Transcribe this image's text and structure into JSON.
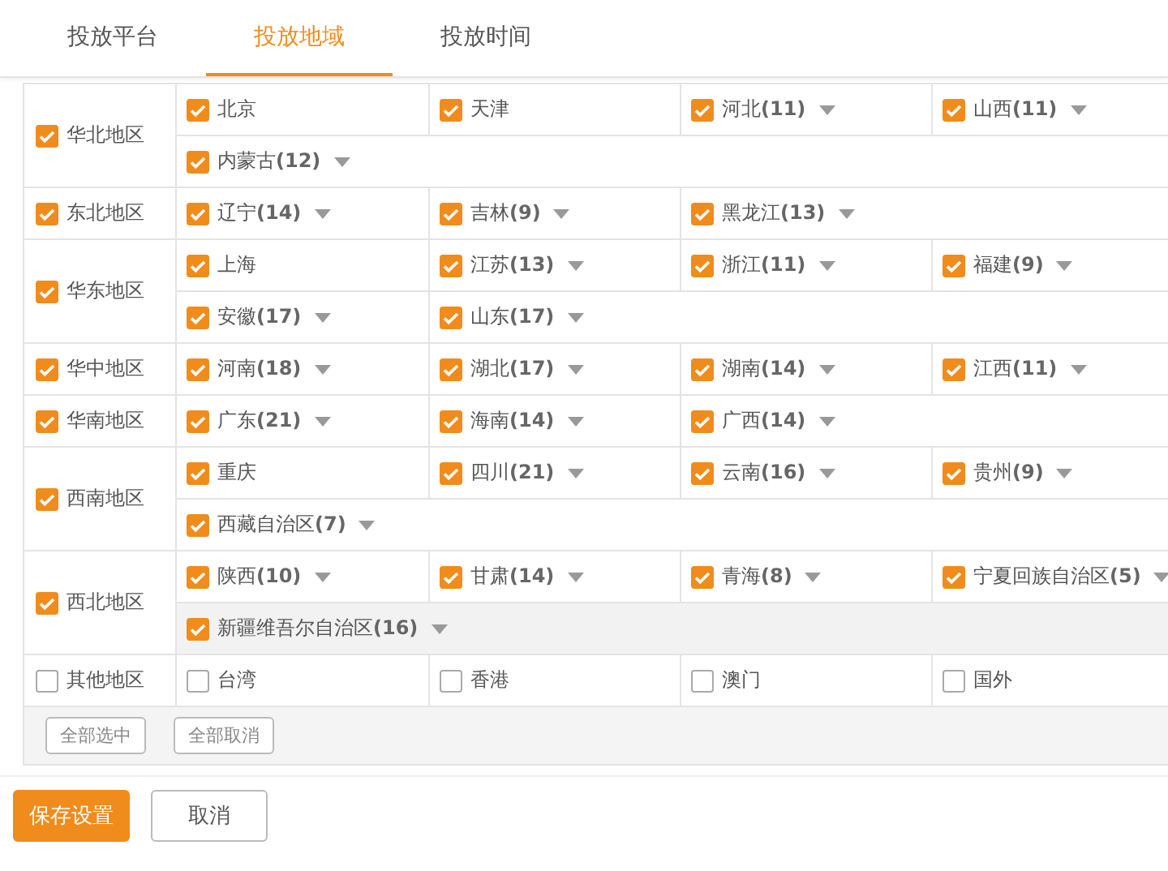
{
  "tabs": [
    {
      "label": "投放平台",
      "selected": false
    },
    {
      "label": "投放地域",
      "selected": true
    },
    {
      "label": "投放时间",
      "selected": false
    }
  ],
  "regions": [
    {
      "name": "华北地区",
      "checked": true,
      "lines": [
        {
          "hovered": false,
          "provinces": [
            {
              "name": "北京",
              "checked": true
            },
            {
              "name": "天津",
              "checked": true
            },
            {
              "name": "河北",
              "count": "(11)",
              "checked": true
            },
            {
              "name": "山西",
              "count": "(11)",
              "checked": true
            }
          ]
        },
        {
          "hovered": false,
          "provinces": [
            {
              "name": "内蒙古",
              "count": "(12)",
              "checked": true
            }
          ]
        }
      ]
    },
    {
      "name": "东北地区",
      "checked": true,
      "lines": [
        {
          "hovered": false,
          "provinces": [
            {
              "name": "辽宁",
              "count": "(14)",
              "checked": true
            },
            {
              "name": "吉林",
              "count": "(9)",
              "checked": true
            },
            {
              "name": "黑龙江",
              "count": "(13)",
              "checked": true
            }
          ]
        }
      ]
    },
    {
      "name": "华东地区",
      "checked": true,
      "lines": [
        {
          "hovered": false,
          "provinces": [
            {
              "name": "上海",
              "checked": true
            },
            {
              "name": "江苏",
              "count": "(13)",
              "checked": true
            },
            {
              "name": "浙江",
              "count": "(11)",
              "checked": true
            },
            {
              "name": "福建",
              "count": "(9)",
              "checked": true
            }
          ]
        },
        {
          "hovered": false,
          "provinces": [
            {
              "name": "安徽",
              "count": "(17)",
              "checked": true
            },
            {
              "name": "山东",
              "count": "(17)",
              "checked": true
            }
          ]
        }
      ]
    },
    {
      "name": "华中地区",
      "checked": true,
      "lines": [
        {
          "hovered": false,
          "provinces": [
            {
              "name": "河南",
              "count": "(18)",
              "checked": true
            },
            {
              "name": "湖北",
              "count": "(17)",
              "checked": true
            },
            {
              "name": "湖南",
              "count": "(14)",
              "checked": true
            },
            {
              "name": "江西",
              "count": "(11)",
              "checked": true
            }
          ]
        }
      ]
    },
    {
      "name": "华南地区",
      "checked": true,
      "lines": [
        {
          "hovered": false,
          "provinces": [
            {
              "name": "广东",
              "count": "(21)",
              "checked": true
            },
            {
              "name": "海南",
              "count": "(14)",
              "checked": true
            },
            {
              "name": "广西",
              "count": "(14)",
              "checked": true
            }
          ]
        }
      ]
    },
    {
      "name": "西南地区",
      "checked": true,
      "lines": [
        {
          "hovered": false,
          "provinces": [
            {
              "name": "重庆",
              "checked": true
            },
            {
              "name": "四川",
              "count": "(21)",
              "checked": true
            },
            {
              "name": "云南",
              "count": "(16)",
              "checked": true
            },
            {
              "name": "贵州",
              "count": "(9)",
              "checked": true
            }
          ]
        },
        {
          "hovered": false,
          "provinces": [
            {
              "name": "西藏自治区",
              "count": "(7)",
              "checked": true
            }
          ]
        }
      ]
    },
    {
      "name": "西北地区",
      "checked": true,
      "lines": [
        {
          "hovered": false,
          "provinces": [
            {
              "name": "陕西",
              "count": "(10)",
              "checked": true
            },
            {
              "name": "甘肃",
              "count": "(14)",
              "checked": true
            },
            {
              "name": "青海",
              "count": "(8)",
              "checked": true
            },
            {
              "name": "宁夏回族自治区",
              "count": "(5)",
              "checked": true
            }
          ]
        },
        {
          "hovered": true,
          "provinces": [
            {
              "name": "新疆维吾尔自治区",
              "count": "(16)",
              "checked": true
            }
          ]
        }
      ]
    },
    {
      "name": "其他地区",
      "checked": false,
      "lines": [
        {
          "hovered": false,
          "provinces": [
            {
              "name": "台湾",
              "checked": false
            },
            {
              "name": "香港",
              "checked": false
            },
            {
              "name": "澳门",
              "checked": false
            },
            {
              "name": "国外",
              "checked": false
            }
          ]
        }
      ]
    }
  ],
  "bulk_buttons": [
    "全部选中",
    "全部取消"
  ],
  "footer_buttons": [
    {
      "label": "保存设置",
      "kind": "primary"
    },
    {
      "label": "取消",
      "kind": "default"
    }
  ]
}
